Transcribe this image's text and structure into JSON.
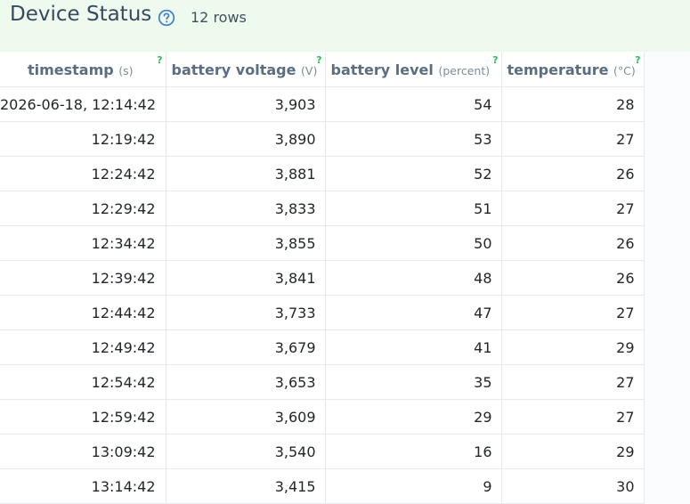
{
  "header": {
    "title": "Device Status",
    "help_icon": "question-circle-icon",
    "rows_label": "12 rows"
  },
  "colors": {
    "header_bg": "#eefaee",
    "help_icon": "#3d7ecb",
    "column_help_marker": "#2fbf5a"
  },
  "columns": [
    {
      "name": "timestamp",
      "unit": "(s)",
      "help": "?"
    },
    {
      "name": "battery voltage",
      "unit": "(V)",
      "help": "?"
    },
    {
      "name": "battery level",
      "unit": "(percent)",
      "help": "?"
    },
    {
      "name": "temperature",
      "unit": "(°C)",
      "help": "?"
    }
  ],
  "rows": [
    [
      "2026-06-18, 12:14:42",
      "3,903",
      "54",
      "28"
    ],
    [
      "12:19:42",
      "3,890",
      "53",
      "27"
    ],
    [
      "12:24:42",
      "3,881",
      "52",
      "26"
    ],
    [
      "12:29:42",
      "3,833",
      "51",
      "27"
    ],
    [
      "12:34:42",
      "3,855",
      "50",
      "26"
    ],
    [
      "12:39:42",
      "3,841",
      "48",
      "26"
    ],
    [
      "12:44:42",
      "3,733",
      "47",
      "27"
    ],
    [
      "12:49:42",
      "3,679",
      "41",
      "29"
    ],
    [
      "12:54:42",
      "3,653",
      "35",
      "27"
    ],
    [
      "12:59:42",
      "3,609",
      "29",
      "27"
    ],
    [
      "13:09:42",
      "3,540",
      "16",
      "29"
    ],
    [
      "13:14:42",
      "3,415",
      "9",
      "30"
    ]
  ]
}
